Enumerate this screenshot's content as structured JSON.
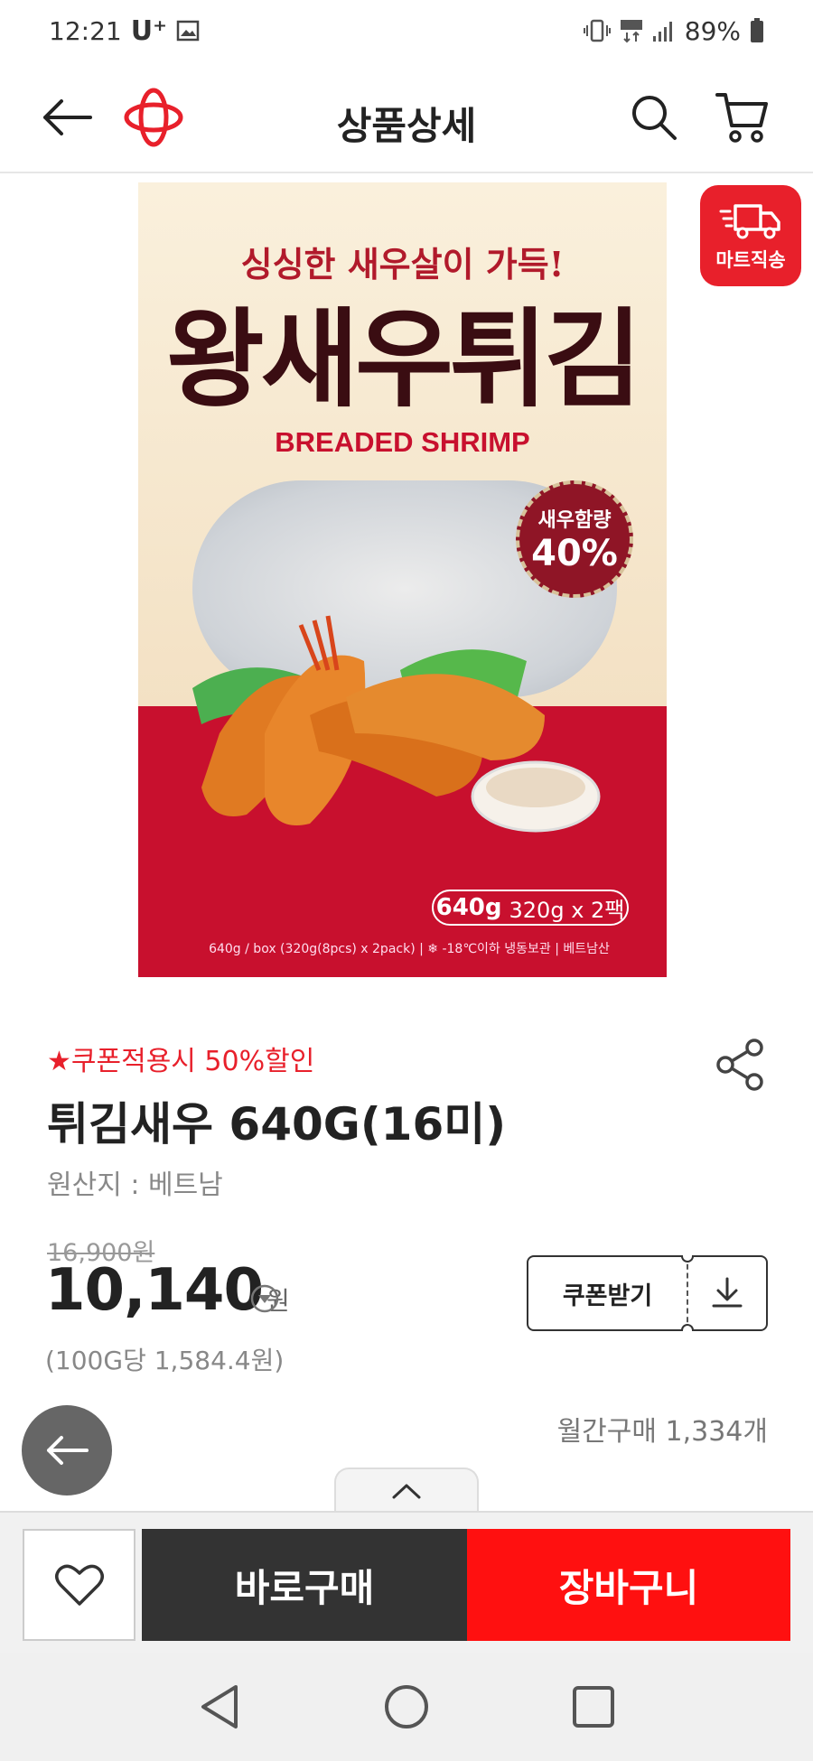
{
  "status_bar": {
    "time": "12:21",
    "carrier": "U⁺",
    "battery": "89%",
    "network": "LTE"
  },
  "header": {
    "title": "상품상세"
  },
  "product_image": {
    "tagline": "싱싱한 새우살이 가득!",
    "title": "왕새우튀김",
    "subtitle": "BREADED SHRIMP",
    "badge_line1": "새우함량",
    "badge_line2": "40%",
    "weight_main": "640g",
    "weight_detail": "320g x 2팩",
    "info": "640g / box (320g(8pcs) x 2pack)  |  ❄ -18℃이하 냉동보관  |  베트남산"
  },
  "delivery_badge": {
    "label": "마트직송"
  },
  "product": {
    "coupon_note": "★쿠폰적용시 50%할인",
    "name": "튀김새우 640G(16미)",
    "origin": "원산지 : 베트남",
    "original_price": "16,900원",
    "sale_price": "10,140",
    "sale_unit": "원",
    "unit_price": "(100G당 1,584.4원)",
    "monthly_sales": "월간구매 1,334개"
  },
  "coupon_button": {
    "label": "쿠폰받기"
  },
  "actions": {
    "buy_now": "바로구매",
    "add_to_cart": "장바구니"
  },
  "colors": {
    "accent_red": "#e8202b",
    "cart_red": "#ff1010",
    "dark": "#333333"
  },
  "icons": [
    "back-arrow-icon",
    "logo-icon",
    "search-icon",
    "cart-icon",
    "truck-icon",
    "share-icon",
    "chevron-down-circle-icon",
    "download-icon",
    "heart-icon",
    "chevron-up-icon"
  ]
}
